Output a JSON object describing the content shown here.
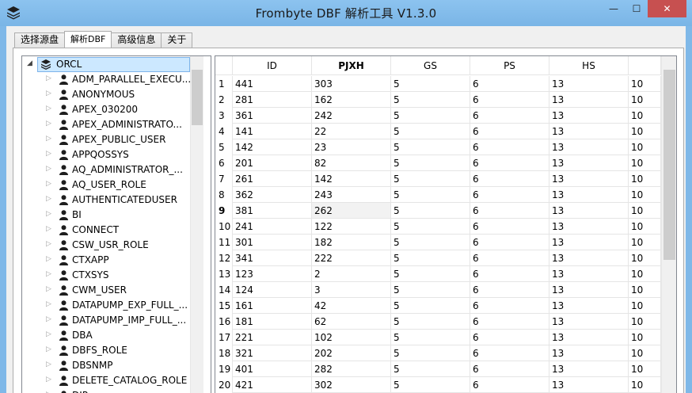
{
  "window": {
    "title": "Frombyte DBF 解析工具  V1.3.0",
    "min_glyph": "—",
    "max_glyph": "☐",
    "close_glyph": "✕"
  },
  "tabs": [
    {
      "label": "选择源盘",
      "active": false
    },
    {
      "label": "解析DBF",
      "active": true
    },
    {
      "label": "高级信息",
      "active": false
    },
    {
      "label": "关于",
      "active": false
    }
  ],
  "tree": {
    "root": {
      "label": "ORCL",
      "expanded": true,
      "icon": "database-icon"
    },
    "items": [
      "ADM_PARALLEL_EXECU...",
      "ANONYMOUS",
      "APEX_030200",
      "APEX_ADMINISTRATO...",
      "APEX_PUBLIC_USER",
      "APPQOSSYS",
      "AQ_ADMINISTRATOR_...",
      "AQ_USER_ROLE",
      "AUTHENTICATEDUSER",
      "BI",
      "CONNECT",
      "CSW_USR_ROLE",
      "CTXAPP",
      "CTXSYS",
      "CWM_USER",
      "DATAPUMP_EXP_FULL_...",
      "DATAPUMP_IMP_FULL_...",
      "DBA",
      "DBFS_ROLE",
      "DBSNMP",
      "DELETE_CATALOG_ROLE",
      "DIP"
    ]
  },
  "table": {
    "columns": [
      "ID",
      "PJXH",
      "GS",
      "PS",
      "HS",
      ""
    ],
    "active_column": "PJXH",
    "selected_row": 9,
    "rows": [
      {
        "n": "1",
        "cells": [
          "441",
          "303",
          "5",
          "6",
          "13",
          "10"
        ]
      },
      {
        "n": "2",
        "cells": [
          "281",
          "162",
          "5",
          "6",
          "13",
          "10"
        ]
      },
      {
        "n": "3",
        "cells": [
          "361",
          "242",
          "5",
          "6",
          "13",
          "10"
        ]
      },
      {
        "n": "4",
        "cells": [
          "141",
          "22",
          "5",
          "6",
          "13",
          "10"
        ]
      },
      {
        "n": "5",
        "cells": [
          "142",
          "23",
          "5",
          "6",
          "13",
          "10"
        ]
      },
      {
        "n": "6",
        "cells": [
          "201",
          "82",
          "5",
          "6",
          "13",
          "10"
        ]
      },
      {
        "n": "7",
        "cells": [
          "261",
          "142",
          "5",
          "6",
          "13",
          "10"
        ]
      },
      {
        "n": "8",
        "cells": [
          "362",
          "243",
          "5",
          "6",
          "13",
          "10"
        ]
      },
      {
        "n": "9",
        "cells": [
          "381",
          "262",
          "5",
          "6",
          "13",
          "10"
        ]
      },
      {
        "n": "10",
        "cells": [
          "241",
          "122",
          "5",
          "6",
          "13",
          "10"
        ]
      },
      {
        "n": "11",
        "cells": [
          "301",
          "182",
          "5",
          "6",
          "13",
          "10"
        ]
      },
      {
        "n": "12",
        "cells": [
          "341",
          "222",
          "5",
          "6",
          "13",
          "10"
        ]
      },
      {
        "n": "13",
        "cells": [
          "123",
          "2",
          "5",
          "6",
          "13",
          "10"
        ]
      },
      {
        "n": "14",
        "cells": [
          "124",
          "3",
          "5",
          "6",
          "13",
          "10"
        ]
      },
      {
        "n": "15",
        "cells": [
          "161",
          "42",
          "5",
          "6",
          "13",
          "10"
        ]
      },
      {
        "n": "16",
        "cells": [
          "181",
          "62",
          "5",
          "6",
          "13",
          "10"
        ]
      },
      {
        "n": "17",
        "cells": [
          "221",
          "102",
          "5",
          "6",
          "13",
          "10"
        ]
      },
      {
        "n": "18",
        "cells": [
          "321",
          "202",
          "5",
          "6",
          "13",
          "10"
        ]
      },
      {
        "n": "19",
        "cells": [
          "401",
          "282",
          "5",
          "6",
          "13",
          "10"
        ]
      },
      {
        "n": "20",
        "cells": [
          "421",
          "302",
          "5",
          "6",
          "13",
          "10"
        ]
      }
    ]
  },
  "colors": {
    "titlebar": "#7fb8e8",
    "close_button": "#c75050",
    "selection": "#cce8ff"
  }
}
